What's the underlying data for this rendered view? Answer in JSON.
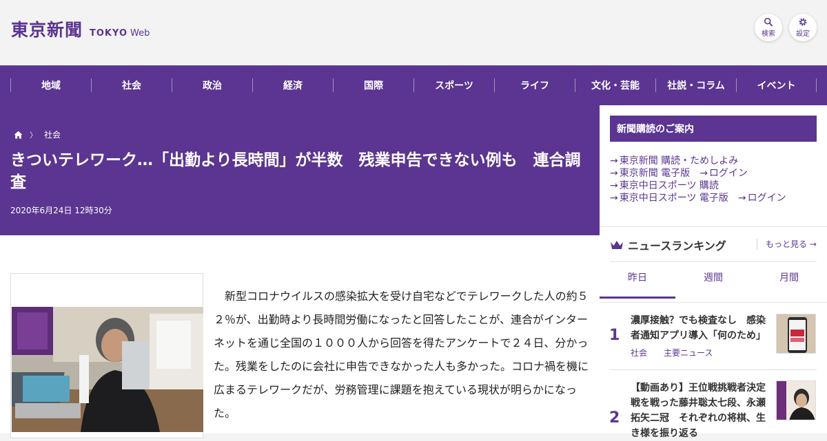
{
  "header": {
    "logo_main": "東京新聞",
    "logo_tokyo": "TOKYO",
    "logo_web": "Web",
    "search_label": "検索",
    "settings_label": "設定"
  },
  "nav": {
    "items": [
      {
        "label": "地域"
      },
      {
        "label": "社会"
      },
      {
        "label": "政治"
      },
      {
        "label": "経済"
      },
      {
        "label": "国際"
      },
      {
        "label": "スポーツ"
      },
      {
        "label": "ライフ"
      },
      {
        "label": "文化・芸能"
      },
      {
        "label": "社説・コラム"
      },
      {
        "label": "イベント"
      }
    ]
  },
  "article": {
    "breadcrumb_sep": "〉",
    "category": "社会",
    "title": "きついテレワーク…「出勤より長時間」が半数　残業申告できない例も　連合調査",
    "date": "2020年6月24日 12時30分",
    "lead": "新型コロナウイルスの感染拡大を受け自宅などでテレワークした人の約５２％が、出勤時より長時間労働になったと回答したことが、連合がインターネットを通じ全国の１０００人から回答を得たアンケートで２４日、分かった。残業をしたのに会社に申告できなかった人も多かった。コロナ禍を機に広まるテレワークだが、労務管理に課題を抱えている現状が明らかになった。"
  },
  "sidebar": {
    "subscribe_title": "新聞購読のご案内",
    "arrow": "→",
    "links": {
      "l1": "東京新聞 購読・ためしよみ",
      "l2a": "東京新聞 電子版",
      "l2b": "ログイン",
      "l3": "東京中日スポーツ 購読",
      "l4a": "東京中日スポーツ 電子版",
      "l4b": "ログイン"
    },
    "ranking_title": "ニュースランキング",
    "more_label": "もっと見る",
    "tabs": [
      "昨日",
      "週間",
      "月間"
    ],
    "ranking": [
      {
        "num": "1",
        "title": "濃厚接触？でも検査なし　感染者通知アプリ導入「何のため」",
        "tag1": "社会",
        "tag2": "主要ニュース"
      },
      {
        "num": "2",
        "title": "【動画あり】王位戦挑戦者決定戦を戦った藤井聡太七段、永瀬拓矢二冠　それぞれの将棋、生き様を振り返る"
      }
    ]
  },
  "colors": {
    "brand_purple": "#5b3591",
    "background": "#f3f3f3"
  }
}
